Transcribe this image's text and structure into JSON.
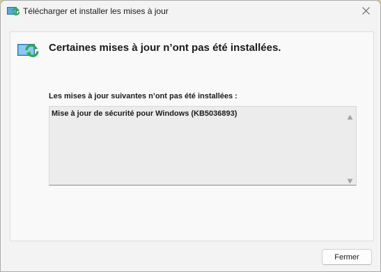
{
  "window": {
    "title": "Télécharger et installer les mises à jour",
    "app_icon": "windows-update-icon",
    "close_icon": "close-icon"
  },
  "header": {
    "icon": "windows-update-large-icon",
    "text": "Certaines mises à jour n’ont pas été installées."
  },
  "list": {
    "label": "Les mises à jour suivantes n’ont pas été installées :",
    "items": [
      "Mise à jour de sécurité pour Windows (KB5036893)"
    ],
    "scroll_up_icon": "scroll-up-arrow-icon",
    "scroll_down_icon": "scroll-down-arrow-icon"
  },
  "footer": {
    "close_button_label": "Fermer"
  },
  "colors": {
    "window_bg": "#f3f3f3",
    "panel_bg": "#f9f9f9",
    "list_bg": "#ececec",
    "icon_green": "#2fa84f",
    "icon_blue": "#4f9fd8"
  }
}
